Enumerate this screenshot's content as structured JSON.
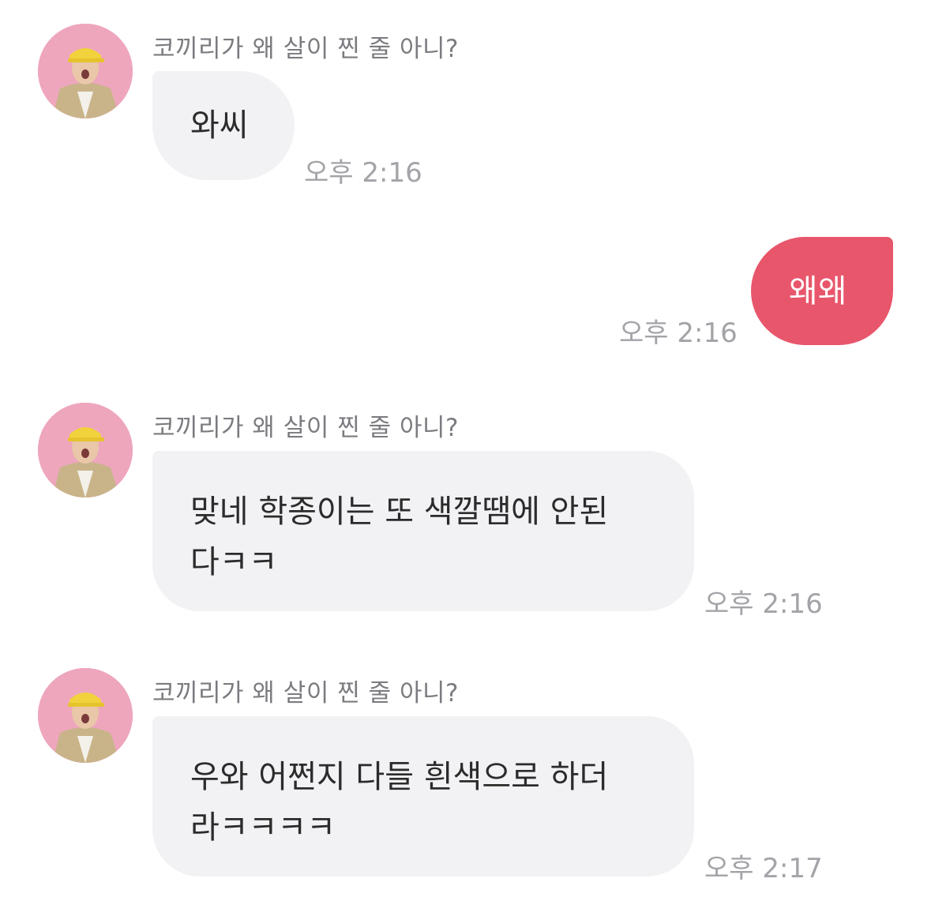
{
  "conversation": {
    "messages": [
      {
        "direction": "incoming",
        "sender": "코끼리가 왜 살이 찐 줄 아니?",
        "text": "와씨",
        "time": "오후 2:16"
      },
      {
        "direction": "outgoing",
        "text": "왜왜",
        "time": "오후 2:16"
      },
      {
        "direction": "incoming",
        "sender": "코끼리가 왜 살이 찐 줄 아니?",
        "text": "맞네 학종이는 또 색깔땜에 안된\n다ㅋㅋ",
        "time": "오후 2:16"
      },
      {
        "direction": "incoming",
        "sender": "코끼리가 왜 살이 찐 줄 아니?",
        "text": "우와 어쩐지 다들 흰색으로 하더\n라ㅋㅋㅋㅋ",
        "time": "오후 2:17"
      }
    ]
  },
  "colors": {
    "incoming_bubble": "#f2f2f5",
    "outgoing_bubble": "#e8566c",
    "timestamp": "#a3a3a8",
    "sender_name": "#7b7b80"
  },
  "icons": {
    "avatar": "profile-photo-person-yellow-cap-pink-background"
  }
}
